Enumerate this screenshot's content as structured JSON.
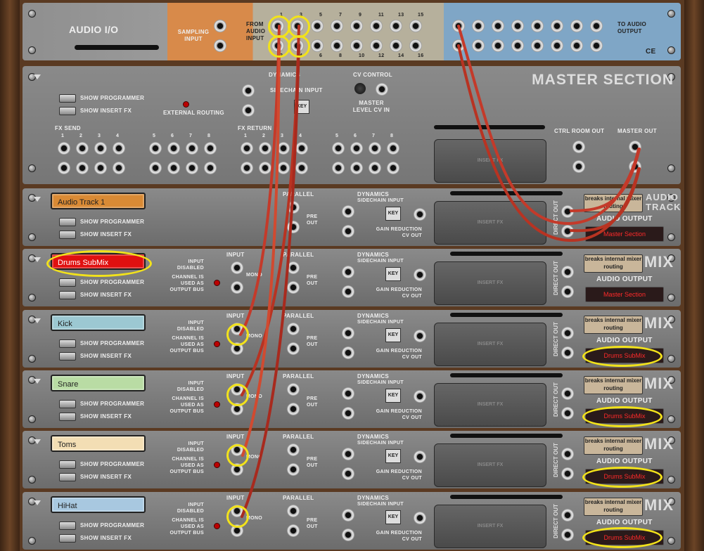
{
  "audio_io": {
    "title": "AUDIO I/O",
    "sampling_input": "SAMPLING INPUT",
    "from_audio_input": "FROM AUDIO INPUT",
    "to_audio_output": "TO AUDIO OUTPUT",
    "ce": "CE",
    "in_numbers_top": [
      "1",
      "3",
      "5",
      "7",
      "9",
      "11",
      "13",
      "15"
    ],
    "in_numbers_bottom": [
      "2",
      "4",
      "6",
      "8",
      "10",
      "12",
      "14",
      "16"
    ]
  },
  "master": {
    "title": "MASTER SECTION",
    "show_programmer": "SHOW PROGRAMMER",
    "show_insert_fx": "SHOW INSERT FX",
    "external_routing": "EXTERNAL ROUTING",
    "dynamics": "DYNAMICS",
    "sidechain_input": "SIDECHAIN INPUT",
    "key": "KEY",
    "cv_control": "CV CONTROL",
    "master_level": "MASTER LEVEL CV IN",
    "fx_send": "FX SEND",
    "fx_return": "FX RETURN",
    "fx_numbers": [
      "1",
      "2",
      "3",
      "4",
      "5",
      "6",
      "7",
      "8"
    ],
    "ctrl_room_out": "CTRL ROOM OUT",
    "master_out": "MASTER OUT",
    "insert_fx": "INSERT FX"
  },
  "tracks": [
    {
      "name": "Audio Track 1",
      "type_title": "AUDIO TRACK",
      "output": "Master Section",
      "input_disabled": false
    },
    {
      "name": "Drums SubMix",
      "type_title": "MIX",
      "output": "Master Section",
      "input_disabled": true
    },
    {
      "name": "Kick",
      "type_title": "MIX",
      "output": "Drums SubMix",
      "input_disabled": true
    },
    {
      "name": "Snare",
      "type_title": "MIX",
      "output": "Drums SubMix",
      "input_disabled": true
    },
    {
      "name": "Toms",
      "type_title": "MIX",
      "output": "Drums SubMix",
      "input_disabled": true
    },
    {
      "name": "HiHat",
      "type_title": "MIX",
      "output": "Drums SubMix",
      "input_disabled": true
    }
  ],
  "common": {
    "show_programmer": "SHOW PROGRAMMER",
    "show_insert_fx": "SHOW INSERT FX",
    "input_disabled": "INPUT DISABLED",
    "channel_output_bus": "CHANNEL IS USED AS OUTPUT BUS",
    "input": "INPUT",
    "mono": "MONO",
    "parallel": "PARALLEL",
    "pre_out": "PRE OUT",
    "dynamics": "DYNAMICS",
    "sidechain_input": "SIDECHAIN INPUT",
    "key": "KEY",
    "gain_reduction": "GAIN REDUCTION CV OUT",
    "insert_fx": "INSERT FX",
    "direct_out": "DIRECT OUT",
    "breaks_internal": "breaks internal mixer routing",
    "audio_output": "AUDIO OUTPUT"
  },
  "colors": {
    "cable": "#c43a2a",
    "highlight": "#f2e21b",
    "io_orange": "#d88a4a",
    "io_blue": "#7fa6c6",
    "panel": "#6a6a6a"
  },
  "track_colors": [
    "#d98a35",
    "#e01010",
    "#9cc8d2",
    "#b9dca4",
    "#f3deb4",
    "#a8c8e0"
  ]
}
